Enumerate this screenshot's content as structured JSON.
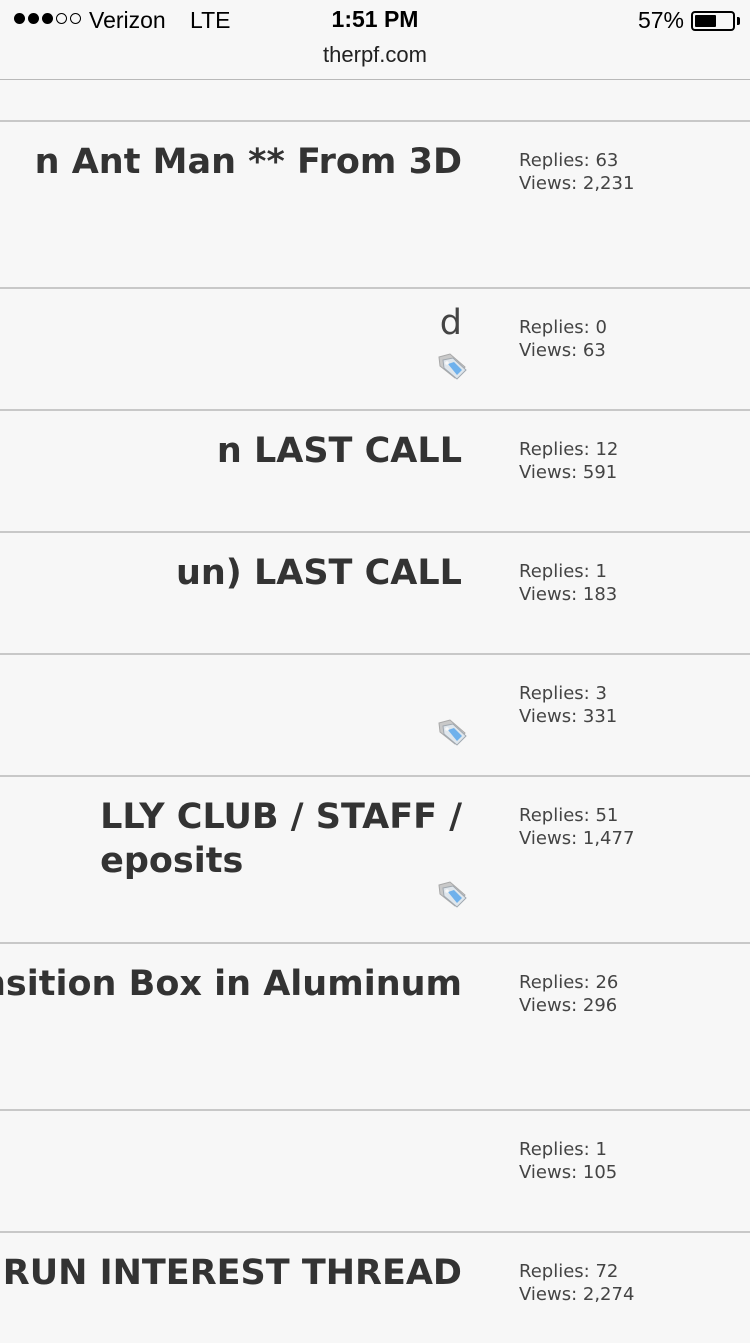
{
  "status_bar": {
    "carrier": "Verizon",
    "network": "LTE",
    "time": "1:51 PM",
    "battery_percent": "57%",
    "battery_level": 0.57,
    "signal_bars_filled": 3,
    "signal_bars_total": 5
  },
  "browser": {
    "url": "therpf.com"
  },
  "threads": [
    {
      "title_lines": [
        "n Ant Man ** From 3D"
      ],
      "replies": "Replies: 63",
      "views": "Views: 2,231",
      "tag_icon": false,
      "light": false
    },
    {
      "title_lines": [
        "d"
      ],
      "replies": "Replies: 0",
      "views": "Views: 63",
      "tag_icon": true,
      "light": true
    },
    {
      "title_lines": [
        "n LAST CALL"
      ],
      "replies": "Replies: 12",
      "views": "Views: 591",
      "tag_icon": false,
      "light": false
    },
    {
      "title_lines": [
        "un) LAST CALL"
      ],
      "replies": "Replies: 1",
      "views": "Views: 183",
      "tag_icon": false,
      "light": false
    },
    {
      "title_lines": [
        ""
      ],
      "replies": "Replies: 3",
      "views": "Views: 331",
      "tag_icon": true,
      "light": false
    },
    {
      "title_lines": [
        "LLY CLUB / STAFF /",
        "eposits"
      ],
      "replies": "Replies: 51",
      "views": "Views: 1,477",
      "tag_icon": true,
      "light": false
    },
    {
      "title_lines": [
        "nsition Box in Aluminum"
      ],
      "replies": "Replies: 26",
      "views": "Views: 296",
      "tag_icon": false,
      "light": false
    },
    {
      "title_lines": [
        ""
      ],
      "replies": "Replies: 1",
      "views": "Views: 105",
      "tag_icon": false,
      "light": false
    },
    {
      "title_lines": [
        "RUN INTEREST THREAD"
      ],
      "replies": "Replies: 72",
      "views": "Views: 2,274",
      "tag_icon": false,
      "light": false
    }
  ],
  "icons": {
    "tag": "tag-icon"
  },
  "colors": {
    "background": "#f7f7f7",
    "text": "#333333",
    "divider": "#c8c8c8"
  }
}
